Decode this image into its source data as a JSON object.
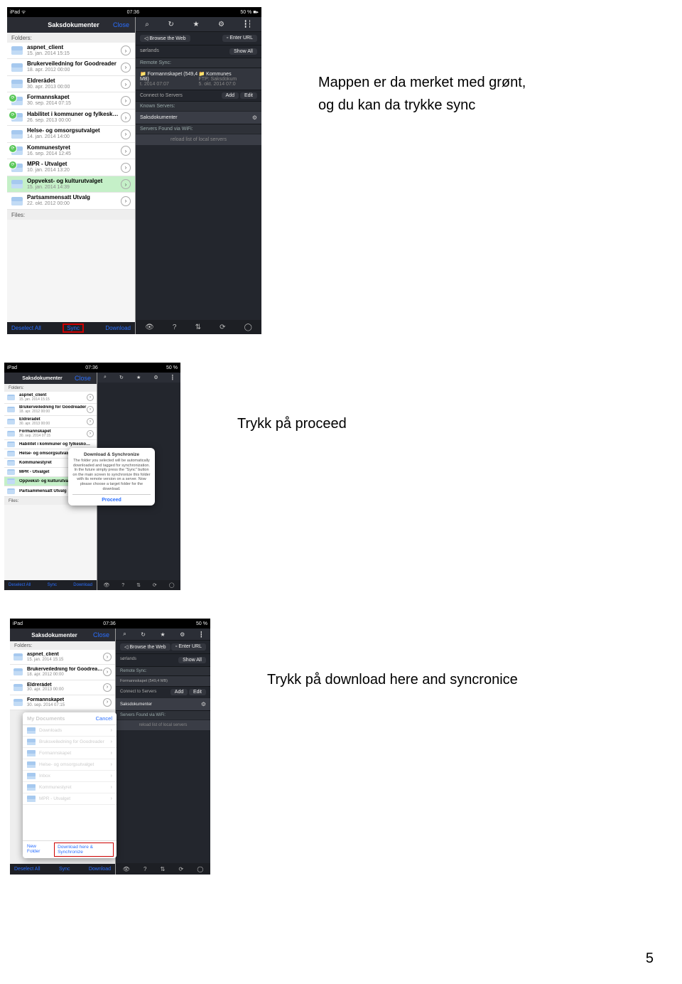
{
  "page_number": "5",
  "instructions": {
    "i1_line1": "Mappen er da merket med grønt,",
    "i1_line2": "og du kan da trykke sync",
    "i2": "Trykk på proceed",
    "i3": "Trykk på download here and syncronice"
  },
  "status": {
    "device": "iPad",
    "wifi": "ᯤ",
    "time1": "07:36",
    "time3": "07:36",
    "battery": "50 %",
    "battglyph": "■▸"
  },
  "panel": {
    "title": "Saksdokumenter",
    "close": "Close",
    "folders_label": "Folders:",
    "files_label": "Files:",
    "footer": {
      "deselect": "Deselect All",
      "sync": "Sync",
      "download": "Download"
    }
  },
  "folders1": [
    {
      "name": "aspnet_client",
      "date": "15. jan. 2014 15:15"
    },
    {
      "name": "Brukerveiledning for Goodreader",
      "date": "18. apr. 2012 00:00"
    },
    {
      "name": "Eldrerådet",
      "date": "30. apr. 2013 00:00"
    },
    {
      "name": "Formannskapet",
      "date": "30. sep. 2014 07:15",
      "badge": true
    },
    {
      "name": "Habilitet i kommuner og fylkeskomm...",
      "date": "26. sep. 2013 00:00",
      "badge": true
    },
    {
      "name": "Helse- og omsorgsutvalget",
      "date": "14. jan. 2014 14:00"
    },
    {
      "name": "Kommunestyret",
      "date": "16. sep. 2014 12:45",
      "badge": true
    },
    {
      "name": "MPR - Utvalget",
      "date": "10. jan. 2014 13:20",
      "badge": true
    },
    {
      "name": "Oppvekst- og kulturutvalget",
      "date": "15. jan. 2014 14:39",
      "selected": true
    },
    {
      "name": "Partsammensatt Utvalg",
      "date": "22. okt. 2012 00:00"
    }
  ],
  "folders3": [
    {
      "name": "aspnet_client",
      "date": "15. jan. 2014 15:15"
    },
    {
      "name": "Brukerveiledning for Goodreader",
      "date": "18. apr. 2012 00:00"
    },
    {
      "name": "Eldrerådet",
      "date": "30. apr. 2013 00:00"
    },
    {
      "name": "Formannskapet",
      "date": "30. sep. 2014 07:15"
    }
  ],
  "darkarea": {
    "browse": "Browse the Web",
    "enterurl": "Enter URL",
    "town": "sørlands",
    "showall": "Show All",
    "remotesync": "Remote Sync:",
    "rs_left_name": "Formannskapet (549,4 MB)",
    "rs_left_date": "t. 2014 07:07",
    "rs_right_name": "Kommunes",
    "rs_right_sub": "FTP: Saksdokum",
    "rs_right_date": "5. okt. 2014 07:0",
    "connect": "Connect to Servers",
    "add": "Add",
    "edit": "Edit",
    "known": "Known Servers:",
    "server": "Saksdokumenter",
    "wifilab": "Servers Found via WiFi:",
    "reload": "reload list of local servers"
  },
  "dialog": {
    "title": "Download & Synchronize",
    "body": "The folder you selected will be automatically downloaded and tagged for synchronization. In the future simply press the \"Sync\" button on the main screen to synchronize this folder with its remote version on a server. Now please choose a target folder for the download.",
    "proceed": "Proceed"
  },
  "subpanel": {
    "title": "My Documents",
    "cancel": "Cancel",
    "rows": [
      "Downloads",
      "Bruksveiledning for Goodreader",
      "Formannskapet",
      "Helse- og omsorgsutvalget",
      "Inbox",
      "Kommunestyret",
      "MPR - Utvalget"
    ],
    "newfolder": "New Folder",
    "dlhere": "Download here & Synchronize"
  }
}
